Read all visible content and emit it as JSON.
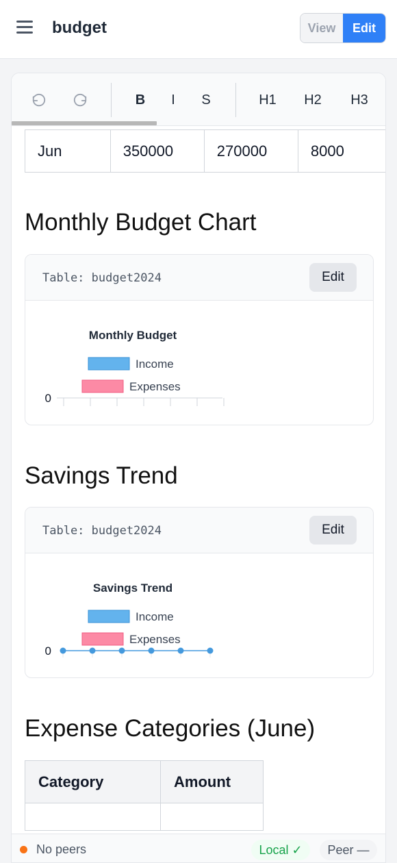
{
  "header": {
    "menu_icon": "hamburger-menu-icon",
    "title": "budget",
    "view_label": "View",
    "edit_label": "Edit",
    "active_mode": "Edit",
    "accent_color": "#2f80f7"
  },
  "toolbar": {
    "undo_icon": "undo-icon",
    "redo_icon": "redo-icon",
    "bold_label": "B",
    "italic_label": "I",
    "strike_label": "S",
    "h1_label": "H1",
    "h2_label": "H2",
    "h3_label": "H3"
  },
  "budget_table": {
    "row": [
      "Jun",
      "350000",
      "270000",
      "8000"
    ]
  },
  "sections": {
    "monthly_chart_heading": "Monthly Budget Chart",
    "savings_heading": "Savings Trend",
    "expense_heading": "Expense Categories (June)"
  },
  "monthly_chart_card": {
    "table_label": "Table: budget2024",
    "edit_label": "Edit"
  },
  "savings_chart_card": {
    "table_label": "Table: budget2024",
    "edit_label": "Edit"
  },
  "chart_data": [
    {
      "type": "bar",
      "title": "Monthly Budget",
      "series": [
        {
          "name": "Income",
          "color": "#63b3ed"
        },
        {
          "name": "Expenses",
          "color": "#fc8aa5"
        }
      ],
      "y_tick_labels": [
        "0"
      ],
      "x_tick_count": 6,
      "legend_position": "top"
    },
    {
      "type": "line",
      "title": "Savings Trend",
      "series": [
        {
          "name": "Income",
          "color": "#63b3ed"
        },
        {
          "name": "Expenses",
          "color": "#fc8aa5"
        }
      ],
      "line_values": [
        0,
        0,
        0,
        0,
        0,
        0
      ],
      "line_color": "#4499dd",
      "y_tick_labels": [
        "0"
      ],
      "legend_position": "top"
    }
  ],
  "expense_table": {
    "headers": [
      "Category",
      "Amount"
    ]
  },
  "status": {
    "peer_status": "No peers",
    "peer_status_color": "#f97316",
    "local_badge": "Local ✓",
    "peer_badge": "Peer —"
  }
}
